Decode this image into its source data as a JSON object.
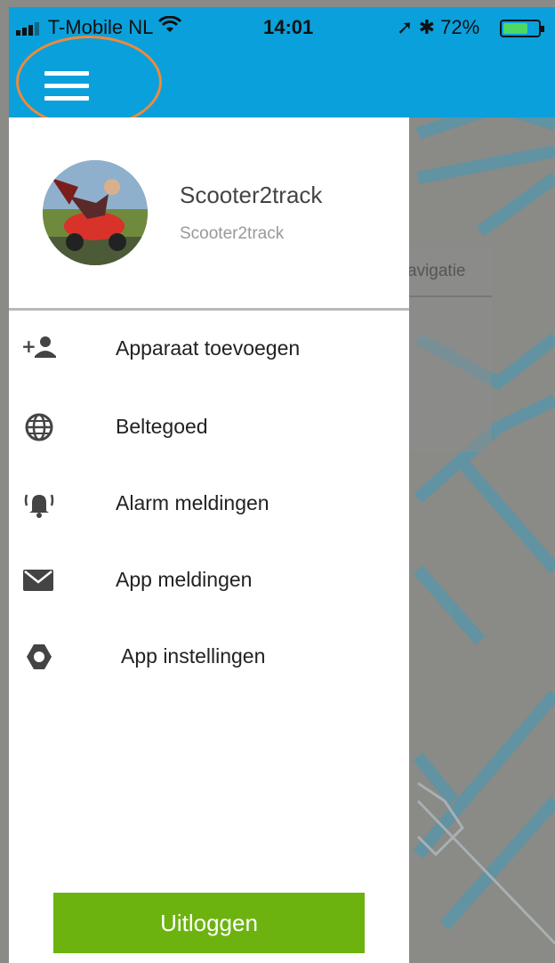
{
  "status_bar": {
    "carrier": "T-Mobile NL",
    "time": "14:01",
    "battery_text": "72%",
    "battery_level": 0.72,
    "battery_color": "#4cd964"
  },
  "header": {
    "background": "#0aa0dc",
    "menu_icon": "hamburger-icon",
    "highlight_color": "#ef8a3a"
  },
  "profile": {
    "name": "Scooter2track",
    "subtitle": "Scooter2track"
  },
  "menu": {
    "items": [
      {
        "label": "Apparaat toevoegen",
        "icon": "add-person-icon"
      },
      {
        "label": "Beltegoed",
        "icon": "globe-icon"
      },
      {
        "label": "Alarm meldingen",
        "icon": "alarm-bell-icon"
      },
      {
        "label": "App meldingen",
        "icon": "envelope-icon"
      },
      {
        "label": "App instellingen",
        "icon": "gear-icon"
      }
    ]
  },
  "logout": {
    "label": "Uitloggen",
    "color": "#6cb310"
  },
  "map": {
    "partial_label": "avigatie"
  }
}
